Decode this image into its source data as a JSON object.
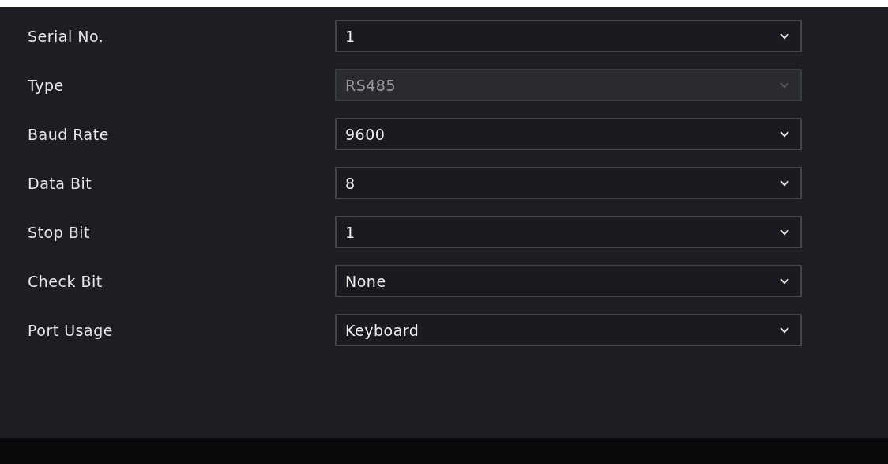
{
  "fields": [
    {
      "label": "Serial No.",
      "value": "1",
      "disabled": false
    },
    {
      "label": "Type",
      "value": "RS485",
      "disabled": true
    },
    {
      "label": "Baud Rate",
      "value": "9600",
      "disabled": false
    },
    {
      "label": "Data Bit",
      "value": "8",
      "disabled": false
    },
    {
      "label": "Stop Bit",
      "value": "1",
      "disabled": false
    },
    {
      "label": "Check Bit",
      "value": "None",
      "disabled": false
    },
    {
      "label": "Port Usage",
      "value": "Keyboard",
      "disabled": false
    }
  ]
}
